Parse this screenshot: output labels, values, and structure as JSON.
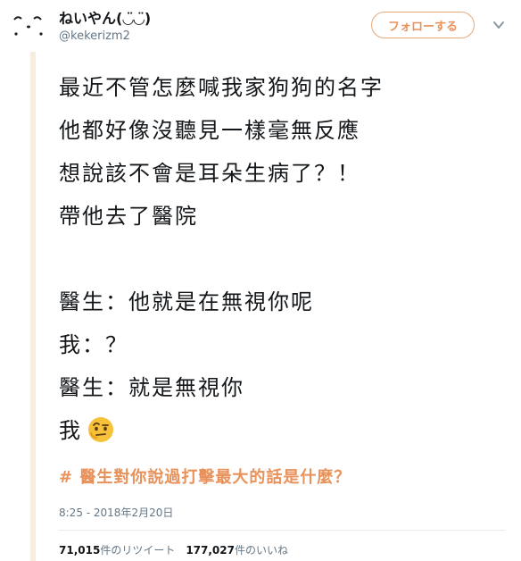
{
  "user": {
    "display_name": "ねいやん(◡̈◡̈)",
    "username": "@kekerizm2"
  },
  "actions": {
    "follow_label": "フォローする",
    "caret_icon": "chevron-down-icon"
  },
  "tweet": {
    "lines": [
      "最近不管怎麼喊我家狗狗的名字",
      "他都好像沒聽見一樣毫無反應",
      "想說該不會是耳朵生病了？！",
      "帶他去了醫院",
      "",
      "醫生：他就是在無視你呢",
      "我：？",
      "醫生：就是無視你",
      "我"
    ],
    "emoji": "face-with-raised-eyebrow-icon",
    "hashtag": "# 醫生對你說過打擊最大的話是什麼？"
  },
  "meta": {
    "timestamp": "8:25 - 2018年2月20日"
  },
  "stats": {
    "retweet_count": "71,015",
    "retweet_label": "件のリツイート",
    "like_count": "177,027",
    "like_label": "件のいいね"
  },
  "colors": {
    "accent": "#e8915a",
    "quote_bar": "#f6ecdf",
    "muted_text": "#657786"
  }
}
